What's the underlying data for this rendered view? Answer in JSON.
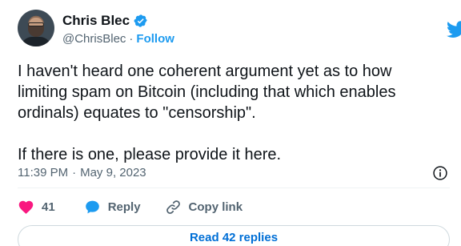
{
  "author": {
    "name": "Chris Blec",
    "handle": "@ChrisBlec",
    "separator": "·",
    "follow_label": "Follow"
  },
  "tweet": {
    "text": "I haven't heard one coherent argument yet as to how\nlimiting spam on Bitcoin (including that which enables\nordinals) equates to \"censorship\".\n\nIf there is one, please provide it here.",
    "time": "11:39 PM",
    "separator": "·",
    "date": "May 9, 2023"
  },
  "actions": {
    "likes_count": "41",
    "reply_label": "Reply",
    "copy_link_label": "Copy link"
  },
  "footer": {
    "read_replies_label": "Read 42 replies"
  },
  "colors": {
    "accent": "#1d9bf0",
    "like": "#f91880",
    "text": "#0f1419",
    "muted": "#536471"
  }
}
